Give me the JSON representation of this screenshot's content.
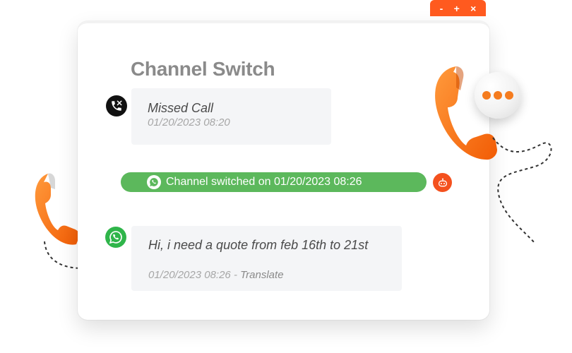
{
  "window": {
    "controls": {
      "minimize": "-",
      "maximize": "+",
      "close": "×"
    },
    "title": "Channel Switch"
  },
  "messages": [
    {
      "channel": "missed-call",
      "text": "Missed Call",
      "timestamp": "01/20/2023 08:20"
    },
    {
      "channel": "whatsapp",
      "text": "Hi, i need a quote from feb 16th to 21st",
      "timestamp": "01/20/2023 08:26",
      "separator": " - ",
      "translate_label": "Translate"
    }
  ],
  "channel_switch": {
    "text": "Channel switched on 01/20/2023 08:26"
  },
  "icons": {
    "missed_call": "missed-call-icon",
    "whatsapp": "whatsapp-icon",
    "bot": "bot-icon",
    "phone": "phone-icon",
    "typing_dots": "typing-dots-icon"
  },
  "colors": {
    "accent_orange": "#ff5a1f",
    "switch_green": "#5cb85c",
    "whatsapp_green": "#2fb54a",
    "title_gray": "#8a8a8a",
    "bubble_bg": "#f4f5f7"
  }
}
